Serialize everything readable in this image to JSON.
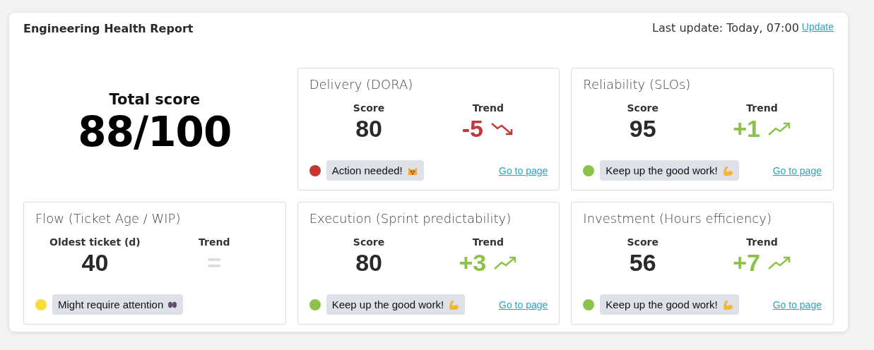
{
  "header": {
    "title": "Engineering Health Report",
    "last_update": "Last update: Today, 07:00",
    "update_link": "Update"
  },
  "total": {
    "label": "Total score",
    "value": "88/100"
  },
  "cards": [
    {
      "title": "Delivery (DORA)",
      "metric_label": "Score",
      "value": "80",
      "trend_label": "Trend",
      "trend": {
        "text": "-5",
        "kind": "down"
      },
      "status": {
        "kind": "alert",
        "color": "#c73535",
        "message": "Action needed!"
      },
      "link": "Go to page"
    },
    {
      "title": "Reliability (SLOs)",
      "metric_label": "Score",
      "value": "95",
      "trend_label": "Trend",
      "trend": {
        "text": "+1",
        "kind": "up"
      },
      "status": {
        "kind": "good",
        "color": "#8bc34a",
        "message": "Keep up the good work!"
      },
      "link": "Go to page"
    },
    {
      "title": "Flow (Ticket Age / WIP)",
      "metric_label": "Oldest ticket (d)",
      "value": "40",
      "trend_label": "Trend",
      "trend": {
        "text": "=",
        "kind": "flat"
      },
      "status": {
        "kind": "warning",
        "color": "#f7dc3a",
        "message": "Might require attention"
      }
    },
    {
      "title": "Execution (Sprint predictability)",
      "metric_label": "Score",
      "value": "80",
      "trend_label": "Trend",
      "trend": {
        "text": "+3",
        "kind": "up"
      },
      "status": {
        "kind": "good",
        "color": "#8bc34a",
        "message": "Keep up the good work!"
      },
      "link": "Go to page"
    },
    {
      "title": "Investment (Hours efficiency)",
      "metric_label": "Score",
      "value": "56",
      "trend_label": "Trend",
      "trend": {
        "text": "+7",
        "kind": "up"
      },
      "status": {
        "kind": "good",
        "color": "#8bc34a",
        "message": "Keep up the good work!"
      },
      "link": "Go to page"
    }
  ]
}
